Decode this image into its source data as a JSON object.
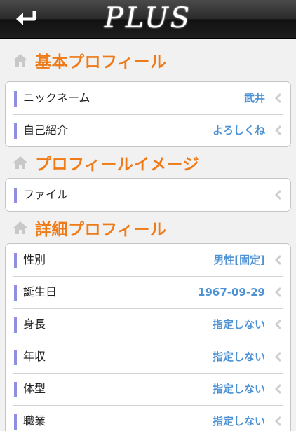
{
  "header": {
    "logo": "PLUS",
    "back_icon": "back-arrow-icon"
  },
  "sections": [
    {
      "title": "基本プロフィール",
      "rows": [
        {
          "label": "ニックネーム",
          "value": "武井"
        },
        {
          "label": "自己紹介",
          "value": "よろしくね"
        }
      ]
    },
    {
      "title": "プロフィールイメージ",
      "rows": [
        {
          "label": "ファイル",
          "value": ""
        }
      ]
    },
    {
      "title": "詳細プロフィール",
      "rows": [
        {
          "label": "性別",
          "value": "男性[固定]"
        },
        {
          "label": "誕生日",
          "value": "1967-09-29"
        },
        {
          "label": "身長",
          "value": "指定しない"
        },
        {
          "label": "年収",
          "value": "指定しない"
        },
        {
          "label": "体型",
          "value": "指定しない"
        },
        {
          "label": "職業",
          "value": "指定しない"
        }
      ]
    }
  ],
  "colors": {
    "accent": "#ee7b18",
    "value": "#4c92d4",
    "bar": "#8f8fe0"
  }
}
